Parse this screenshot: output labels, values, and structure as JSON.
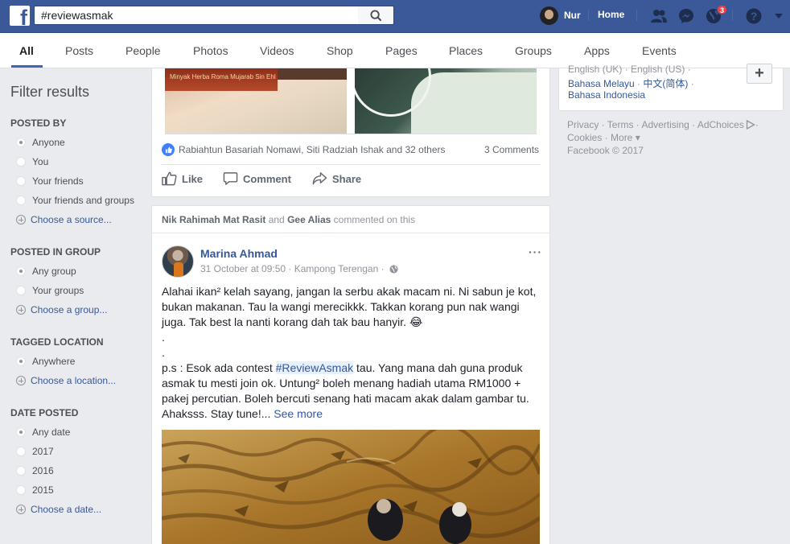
{
  "topbar": {
    "logo": "f",
    "search_value": "#reviewasmak",
    "profile_name": "Nur",
    "home_label": "Home",
    "notification_count": "3"
  },
  "tabs": [
    "All",
    "Posts",
    "People",
    "Photos",
    "Videos",
    "Shop",
    "Pages",
    "Places",
    "Groups",
    "Apps",
    "Events"
  ],
  "filters": {
    "title": "Filter results",
    "posted_by": {
      "label": "POSTED BY",
      "options": [
        "Anyone",
        "You",
        "Your friends",
        "Your friends and groups"
      ],
      "choose": "Choose a source..."
    },
    "posted_in_group": {
      "label": "POSTED IN GROUP",
      "options": [
        "Any group",
        "Your groups"
      ],
      "choose": "Choose a group..."
    },
    "tagged_location": {
      "label": "TAGGED LOCATION",
      "options": [
        "Anywhere"
      ],
      "choose": "Choose a location..."
    },
    "date_posted": {
      "label": "DATE POSTED",
      "options": [
        "Any date",
        "2017",
        "2016",
        "2015"
      ],
      "choose": "Choose a date..."
    }
  },
  "post1": {
    "image_text": "Minyak Herba Roma Mujarab Sin Ehl",
    "reactions": "Rabiahtun Basariah Nomawi, Siti Radziah Ishak and 32 others",
    "comments": "3 Comments",
    "actions": {
      "like": "Like",
      "comment": "Comment",
      "share": "Share"
    }
  },
  "post2": {
    "story_actor1": "Nik Rahimah Mat Rasit",
    "story_and": " and ",
    "story_actor2": "Gee Alias",
    "story_suffix": " commented on this",
    "author": "Marina Ahmad",
    "meta": "31 October at 09:50 · Kampong Terengan ·",
    "more": "···",
    "line1": "Alahai ikan² kelah sayang, jangan la serbu akak macam ni. Ni sabun je kot, bukan makanan. Tau la wangi merecikkk. Takkan korang pun nak wangi juga. Tak best la nanti korang dah tak bau hanyir. 😂",
    "dot1": ".",
    "dot2": ".",
    "ps_prefix": "p.s : Esok ada contest ",
    "hashtag": "#ReviewAsmak",
    "ps_rest": " tau. Yang mana dah guna produk asmak tu mesti join ok. Untung² boleh menang hadiah utama RM1000 + pakej percutian. Boleh bercuti senang hati macam akak dalam gambar tu. Ahaksss. Stay tune!... ",
    "see_more": "See more"
  },
  "right": {
    "languages_row1": "English (UK) · English (US) ·",
    "languages_row2_a": "Bahasa Melayu",
    "languages_row2_b": " · ",
    "languages_row2_c": "中文(简体)",
    "languages_row2_d": " ·",
    "languages_row3": "Bahasa Indonesia",
    "plus": "+",
    "footer_row1": "Privacy · Terms · Advertising · AdChoices",
    "footer_row1_tail": " ·",
    "footer_row2": "Cookies · More ▾",
    "footer_row3": "Facebook © 2017"
  },
  "colors": {
    "brand_blue": "#3b5998",
    "link_blue": "#365899",
    "accent": "#4267b2",
    "badge_red": "#fa3e3e"
  }
}
